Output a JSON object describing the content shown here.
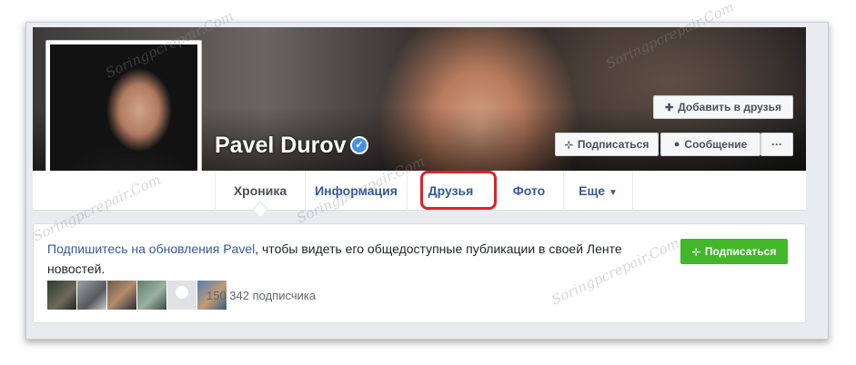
{
  "profile": {
    "name": "Pavel Durov",
    "verified_mark": "✓"
  },
  "actions": {
    "add_friend": "Добавить в друзья",
    "subscribe": "Подписаться",
    "message": "Сообщение",
    "more": "···"
  },
  "tabs": [
    {
      "label": "Хроника"
    },
    {
      "label": "Информация"
    },
    {
      "label": "Друзья"
    },
    {
      "label": "Фото"
    },
    {
      "label": "Еще"
    }
  ],
  "follow_card": {
    "link_text": "Подпишитесь на обновления Pavel",
    "text": ", чтобы видеть его общедоступные публикации в своей Ленте новостей.",
    "button": "Подписаться",
    "subscribers": "150 342 подписчика"
  },
  "icons": {
    "add_friend": "add-person-icon",
    "rss": "rss-icon",
    "messenger": "messenger-icon",
    "more": "ellipsis-icon",
    "dropdown": "caret-down-icon"
  },
  "colors": {
    "link": "#365899",
    "green": "#42b72a",
    "highlight": "#d9242c",
    "verified": "#4a90e2"
  },
  "watermark": "Soringpcrepair.Com"
}
